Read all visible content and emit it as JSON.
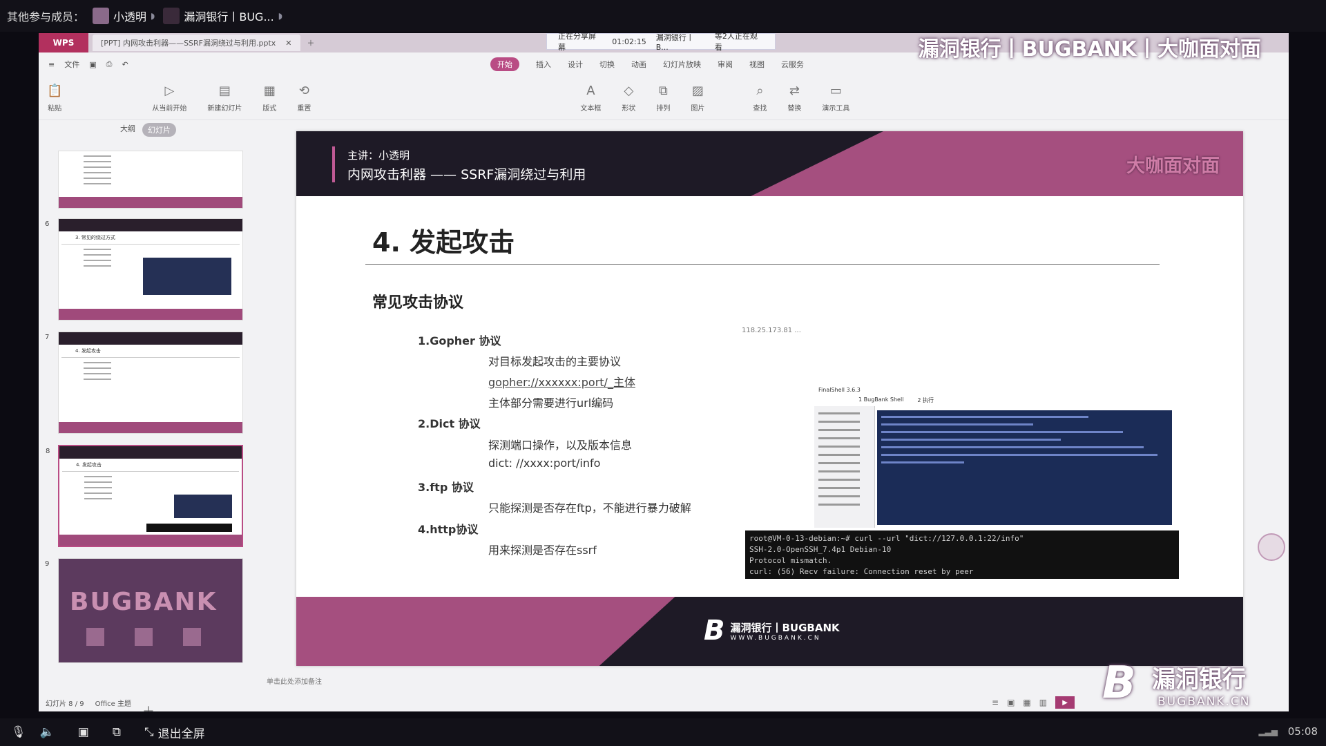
{
  "topbar": {
    "label": "其他参与成员：",
    "participants": [
      {
        "name": "小透明",
        "avatar_color": "#8a6a8a"
      },
      {
        "name": "漏洞银行丨BUG...",
        "avatar_color": "#3a2a3a"
      }
    ]
  },
  "wps": {
    "app": "WPS",
    "doc_tab": "[PPT] 内网攻击利器——SSRF漏洞绕过与利用.pptx",
    "share_bar": {
      "status": "正在分享屏幕",
      "time": "01:02:15",
      "who": "漏洞银行丨B...",
      "viewers": "等2人正在观看"
    },
    "menu_left": [
      "文件",
      "开始"
    ],
    "ribbon_tabs": [
      "开始",
      "插入",
      "设计",
      "切换",
      "动画",
      "幻灯片放映",
      "审阅",
      "视图",
      "云服务"
    ],
    "active_tab": "开始",
    "ribbon_buttons": [
      "粘贴",
      "从当前开始",
      "新建幻灯片",
      "版式",
      "重置",
      "文本框",
      "形状",
      "排列",
      "图片",
      "查找",
      "替换",
      "演示工具"
    ]
  },
  "thumbnails": {
    "tabs": [
      "大纲",
      "幻灯片"
    ],
    "active": "幻灯片",
    "slides": [
      {
        "num": "5",
        "title": ""
      },
      {
        "num": "6",
        "title": "3. 常见的绕过方式"
      },
      {
        "num": "7",
        "title": "4. 发起攻击"
      },
      {
        "num": "8",
        "title": "4. 发起攻击"
      },
      {
        "num": "9",
        "title": "BUGBANK"
      }
    ]
  },
  "slide": {
    "presenter": "主讲：小透明",
    "topic": "内网攻击利器 —— SSRF漏洞绕过与利用",
    "brand": "大咖面对面",
    "title": "4. 发起攻击",
    "subhead": "常见攻击协议",
    "sections": [
      {
        "title": "1.Gopher 协议",
        "lines": [
          "对目标发起攻击的主要协议",
          "gopher://xxxxxx:port/_主体",
          "主体部分需要进行url编码"
        ]
      },
      {
        "title": "2.Dict 协议",
        "lines": [
          "探测端口操作，以及版本信息",
          "dict: //xxxx:port/info"
        ]
      },
      {
        "title": "3.ftp 协议",
        "lines": [
          "只能探测是否存在ftp，不能进行暴力破解"
        ]
      },
      {
        "title": "4.http协议",
        "lines": [
          "用来探测是否存在ssrf"
        ]
      }
    ],
    "screenshot": {
      "caption": "118.25.173.81 ...",
      "window_title": "FinalShell 3.6.3",
      "tabs": [
        "1 BugBank Shell",
        "2 执行"
      ]
    },
    "terminal": [
      "root@VM-0-13-debian:~# curl --url \"dict://127.0.0.1:22/info\"",
      "SSH-2.0-OpenSSH_7.4p1 Debian-10",
      "Protocol mismatch.",
      "curl: (56) Recv failure: Connection reset by peer"
    ],
    "footer_logo_cn": "漏洞银行丨BUGBANK",
    "footer_logo_url": "WWW.BUGBANK.CN"
  },
  "status": {
    "slide_counter": "幻灯片 8 / 9",
    "theme": "Office 主题",
    "notes_placeholder": "单击此处添加备注"
  },
  "watermark": {
    "top": "漏洞银行丨BUGBANK丨大咖面对面",
    "br_cn": "漏洞银行",
    "br_en": "BUGBANK.CN"
  },
  "bottombar": {
    "exit_fullscreen": "退出全屏",
    "clock": "05:08"
  }
}
